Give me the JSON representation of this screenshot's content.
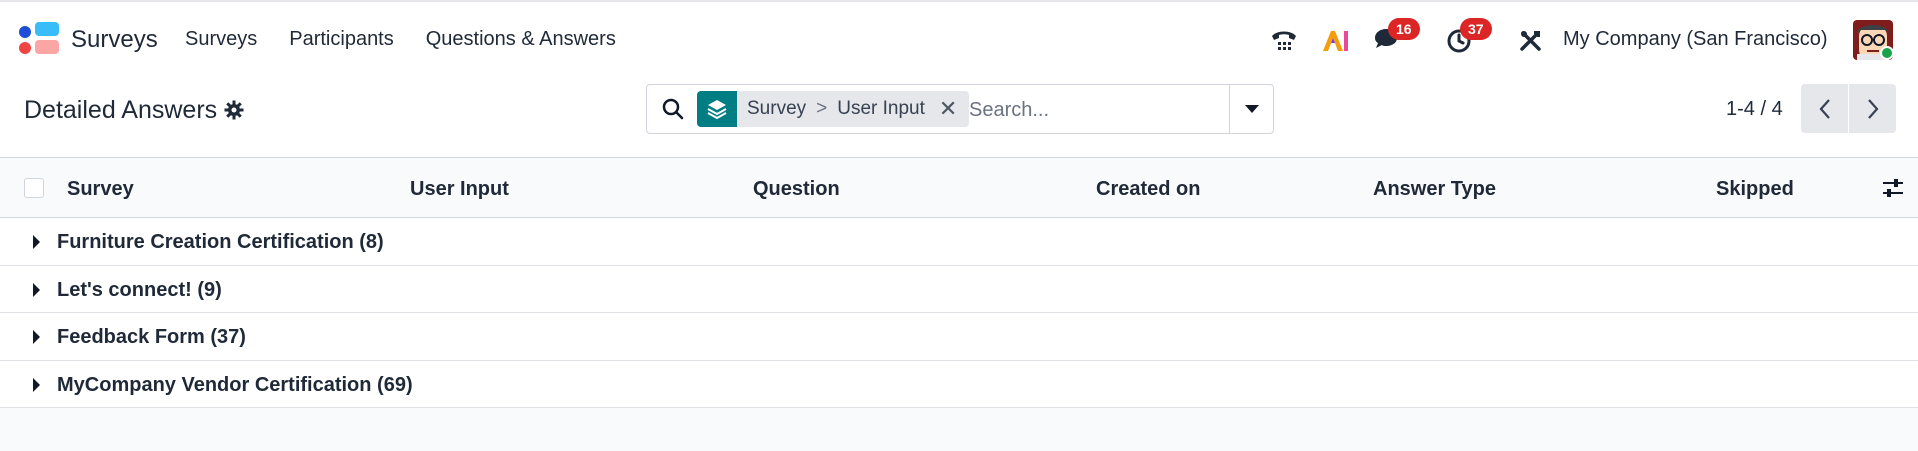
{
  "navbar": {
    "app_name": "Surveys",
    "menu": [
      {
        "label": "Surveys"
      },
      {
        "label": "Participants"
      },
      {
        "label": "Questions & Answers"
      }
    ],
    "systray": {
      "messages_badge": "16",
      "activities_badge": "37",
      "company": "My Company (San Francisco)"
    }
  },
  "control_panel": {
    "title": "Detailed Answers",
    "search": {
      "facet_parts": [
        "Survey",
        ">",
        "User Input"
      ],
      "placeholder": "Search..."
    },
    "pager": {
      "value": "1-4 / 4"
    }
  },
  "list": {
    "columns": [
      "Survey",
      "User Input",
      "Question",
      "Created on",
      "Answer Type",
      "Skipped"
    ],
    "groups": [
      {
        "label": "Furniture Creation Certification (8)"
      },
      {
        "label": "Let's connect! (9)"
      },
      {
        "label": "Feedback Form (37)"
      },
      {
        "label": "MyCompany Vendor Certification (69)"
      }
    ]
  },
  "colors": {
    "accent": "#017e84",
    "badge": "#dc2626",
    "presence": "#16a34a"
  }
}
